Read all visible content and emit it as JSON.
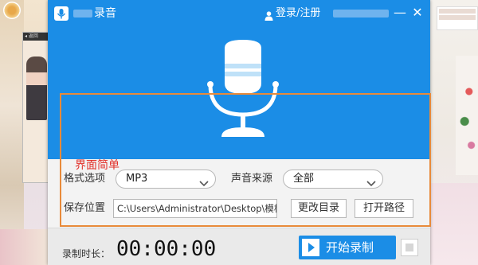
{
  "app": {
    "title": "录音",
    "login_label": "登录/注册",
    "minimize_glyph": "—",
    "close_glyph": "✕"
  },
  "annotation": "界面简单",
  "form": {
    "format_label": "格式选项",
    "format_value": "MP3",
    "source_label": "声音来源",
    "source_value": "全部",
    "save_label": "保存位置",
    "save_path": "C:\\Users\\Administrator\\Desktop\\模板",
    "change_dir_label": "更改目录",
    "open_path_label": "打开路径"
  },
  "footer": {
    "duration_label": "录制时长：",
    "duration_value": "00:00:00",
    "start_label": "开始录制"
  },
  "background": {
    "phone_bar_text": "◂ 返回"
  },
  "colors": {
    "brand_blue": "#1b8de6",
    "annotation_red": "#e2312a",
    "highlight_orange": "#e88a3a"
  },
  "icons": [
    "app-logo-icon",
    "user-icon",
    "microphone-icon",
    "chevron-down-icon",
    "play-icon",
    "stop-icon"
  ]
}
